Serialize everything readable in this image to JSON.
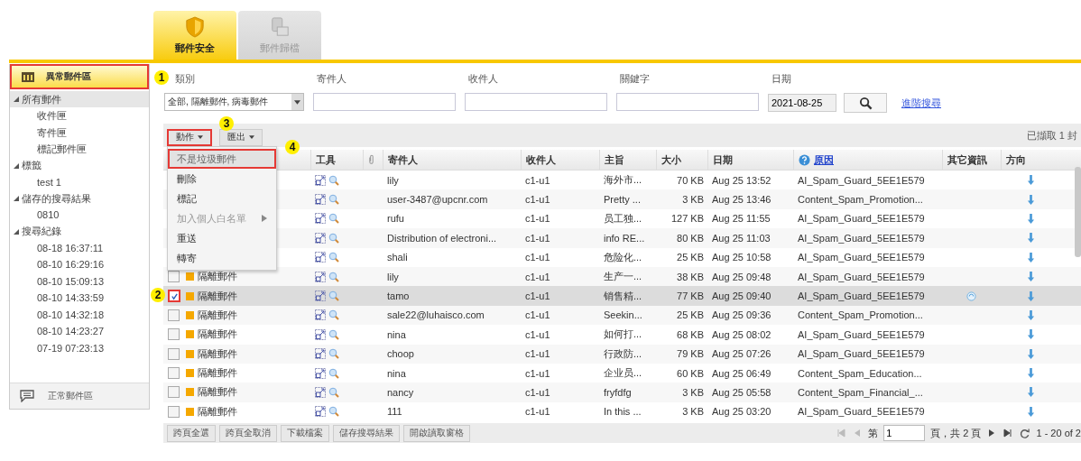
{
  "tabs": [
    {
      "label": "郵件安全",
      "kind": "shield",
      "selected": true
    },
    {
      "label": "郵件歸檔",
      "kind": "archive",
      "selected": false
    }
  ],
  "sidebar": {
    "top_item": {
      "label": "異常郵件區",
      "selected": true,
      "outlined": true
    },
    "tree": [
      {
        "label": "所有郵件",
        "expanded": true,
        "selected": true,
        "children": [
          {
            "label": "收件匣",
            "selected": false
          },
          {
            "label": "寄件匣",
            "selected": false
          },
          {
            "label": "標記郵件匣",
            "selected": false
          }
        ]
      },
      {
        "label": "標籤",
        "expanded": true,
        "selected": false,
        "children": [
          {
            "label": "test 1",
            "selected": false
          }
        ]
      },
      {
        "label": "儲存的搜尋結果",
        "expanded": true,
        "selected": false,
        "children": [
          {
            "label": "0810",
            "selected": false
          }
        ]
      },
      {
        "label": "搜尋紀錄",
        "expanded": true,
        "selected": false,
        "children": [
          {
            "label": "08-18 16:37:11",
            "selected": false
          },
          {
            "label": "08-10 16:29:16",
            "selected": false
          },
          {
            "label": "08-10 15:09:13",
            "selected": false
          },
          {
            "label": "08-10 14:33:59",
            "selected": false
          },
          {
            "label": "08-10 14:32:18",
            "selected": false
          },
          {
            "label": "08-10 14:23:27",
            "selected": false
          },
          {
            "label": "07-19 07:23:13",
            "selected": false
          }
        ]
      }
    ],
    "bottom_item": {
      "label": "正常郵件區",
      "selected": false
    }
  },
  "filters": {
    "category": {
      "label": "類別",
      "value": "全部, 隔離郵件, 病毒郵件"
    },
    "sender": {
      "label": "寄件人"
    },
    "recipient": {
      "label": "收件人"
    },
    "keyword": {
      "label": "關鍵字"
    },
    "date": {
      "label": "日期",
      "value": "2021-08-25"
    },
    "advanced_link": "進階搜尋"
  },
  "toolbar": {
    "buttons": [
      {
        "label": "動作",
        "outlined": true
      },
      {
        "label": "匯出",
        "outlined": false
      }
    ],
    "selected_count": "已擷取 1 封"
  },
  "menu": [
    {
      "label": "不是垃圾郵件",
      "selected": true,
      "disabled": false,
      "submenu": false
    },
    {
      "label": "刪除",
      "selected": false,
      "disabled": false,
      "submenu": false
    },
    {
      "label": "標記",
      "selected": false,
      "disabled": false,
      "submenu": false
    },
    {
      "label": "加入個人白名單",
      "selected": false,
      "disabled": true,
      "submenu": true
    },
    {
      "label": "重送",
      "selected": false,
      "disabled": false,
      "submenu": false
    },
    {
      "label": "轉寄",
      "selected": false,
      "disabled": false,
      "submenu": false
    }
  ],
  "table": {
    "columns": [
      "工具",
      "寄件人",
      "收件人",
      "主旨",
      "大小",
      "日期",
      "原因",
      "其它資訊",
      "方向"
    ],
    "rows": [
      {
        "selected": false,
        "other_info": false,
        "sender": "lily",
        "recipient": "c1-u1",
        "subject": "海外市...",
        "size": "70 KB",
        "date": "Aug 25 13:52",
        "reason": "AI_Spam_Guard_5EE1E579"
      },
      {
        "selected": false,
        "other_info": false,
        "sender": "user-3487@upcnr.com",
        "recipient": "c1-u1",
        "subject": "Pretty ...",
        "size": "3 KB",
        "date": "Aug 25 13:46",
        "reason": "Content_Spam_Promotion..."
      },
      {
        "selected": false,
        "other_info": false,
        "sender": "rufu",
        "recipient": "c1-u1",
        "subject": "员工独...",
        "size": "127 KB",
        "date": "Aug 25 11:55",
        "reason": "AI_Spam_Guard_5EE1E579"
      },
      {
        "selected": false,
        "other_info": false,
        "sender": "Distribution of electroni...",
        "recipient": "c1-u1",
        "subject": "info RE...",
        "size": "80 KB",
        "date": "Aug 25 11:03",
        "reason": "AI_Spam_Guard_5EE1E579"
      },
      {
        "selected": false,
        "other_info": false,
        "sender": "shali",
        "recipient": "c1-u1",
        "subject": "危险化...",
        "size": "25 KB",
        "date": "Aug 25 10:58",
        "reason": "AI_Spam_Guard_5EE1E579"
      },
      {
        "selected": false,
        "checked": false,
        "outlined": false,
        "type": "隔離郵件",
        "color": "#f5a800",
        "other_info": false,
        "sender": "lily",
        "recipient": "c1-u1",
        "subject": "生产一...",
        "size": "38 KB",
        "date": "Aug 25 09:48",
        "reason": "AI_Spam_Guard_5EE1E579"
      },
      {
        "selected": true,
        "checked": true,
        "outlined": true,
        "type": "隔離郵件",
        "color": "#f5a800",
        "other_info": true,
        "sender": "tamo",
        "recipient": "c1-u1",
        "subject": "销售精...",
        "size": "77 KB",
        "date": "Aug 25 09:40",
        "reason": "AI_Spam_Guard_5EE1E579"
      },
      {
        "selected": false,
        "checked": false,
        "outlined": false,
        "type": "隔離郵件",
        "color": "#f5a800",
        "other_info": false,
        "sender": "sale22@luhaisco.com",
        "recipient": "c1-u1",
        "subject": "Seekin...",
        "size": "25 KB",
        "date": "Aug 25 09:36",
        "reason": "Content_Spam_Promotion..."
      },
      {
        "selected": false,
        "checked": false,
        "outlined": false,
        "type": "隔離郵件",
        "color": "#f5a800",
        "other_info": false,
        "sender": "nina",
        "recipient": "c1-u1",
        "subject": "如何打...",
        "size": "68 KB",
        "date": "Aug 25 08:02",
        "reason": "AI_Spam_Guard_5EE1E579"
      },
      {
        "selected": false,
        "checked": false,
        "outlined": false,
        "type": "隔離郵件",
        "color": "#f5a800",
        "other_info": false,
        "sender": "choop",
        "recipient": "c1-u1",
        "subject": "行政防...",
        "size": "79 KB",
        "date": "Aug 25 07:26",
        "reason": "AI_Spam_Guard_5EE1E579"
      },
      {
        "selected": false,
        "checked": false,
        "outlined": false,
        "type": "隔離郵件",
        "color": "#f5a800",
        "other_info": false,
        "sender": "nina",
        "recipient": "c1-u1",
        "subject": "企业员...",
        "size": "60 KB",
        "date": "Aug 25 06:49",
        "reason": "Content_Spam_Education..."
      },
      {
        "selected": false,
        "checked": false,
        "outlined": false,
        "type": "隔離郵件",
        "color": "#f5a800",
        "other_info": false,
        "sender": "nancy",
        "recipient": "c1-u1",
        "subject": "fryfdfg",
        "size": "3 KB",
        "date": "Aug 25 05:58",
        "reason": "Content_Spam_Financial_..."
      },
      {
        "selected": false,
        "checked": false,
        "outlined": false,
        "type": "隔離郵件",
        "color": "#f5a800",
        "other_info": false,
        "sender": "111",
        "recipient": "c1-u1",
        "subject": "In this ...",
        "size": "3 KB",
        "date": "Aug 25 03:20",
        "reason": "AI_Spam_Guard_5EE1E579"
      }
    ]
  },
  "bottom_buttons": [
    "跨頁全選",
    "跨頁全取消",
    "下載檔案",
    "儲存搜尋結果",
    "開啟讀取窗格"
  ],
  "pager": {
    "page_prefix": "第",
    "page": "1",
    "page_suffix": "頁，共 2 頁",
    "range": "1 - 20 of 2"
  },
  "callouts": [
    "1",
    "2",
    "3",
    "4"
  ]
}
